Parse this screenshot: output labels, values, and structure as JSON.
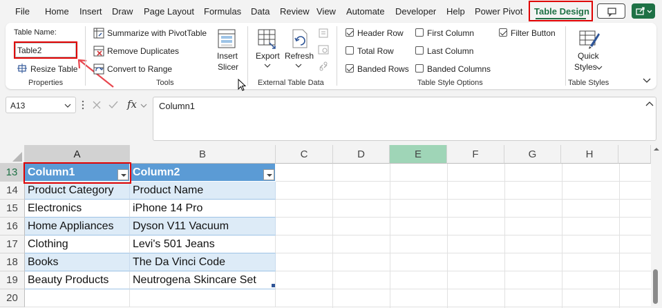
{
  "menu": {
    "tabs": [
      "File",
      "Home",
      "Insert",
      "Draw",
      "Page Layout",
      "Formulas",
      "Data",
      "Review",
      "View",
      "Automate",
      "Developer",
      "Help",
      "Power Pivot",
      "Table Design"
    ]
  },
  "ribbon": {
    "properties": {
      "table_name_label": "Table Name:",
      "table_name_value": "Table2",
      "resize_label": "Resize Table",
      "group_label": "Properties"
    },
    "tools": {
      "summarize_label": "Summarize with PivotTable",
      "remove_dup_label": "Remove Duplicates",
      "convert_label": "Convert to Range",
      "insert_slicer_line1": "Insert",
      "insert_slicer_line2": "Slicer",
      "group_label": "Tools"
    },
    "external": {
      "export_label": "Export",
      "refresh_label": "Refresh",
      "group_label": "External Table Data"
    },
    "style_options": {
      "header_row": "Header Row",
      "total_row": "Total Row",
      "banded_rows": "Banded Rows",
      "first_column": "First Column",
      "last_column": "Last Column",
      "banded_columns": "Banded Columns",
      "filter_button": "Filter Button",
      "group_label": "Table Style Options"
    },
    "styles": {
      "quick_line1": "Quick",
      "quick_line2": "Styles",
      "group_label": "Table Styles"
    }
  },
  "formula_bar": {
    "name_box": "A13",
    "fx": "fx",
    "content": "Column1"
  },
  "grid": {
    "columns": [
      "A",
      "B",
      "C",
      "D",
      "E",
      "F",
      "G",
      "H"
    ],
    "rows": [
      "13",
      "14",
      "15",
      "16",
      "17",
      "18",
      "19",
      "20"
    ],
    "table_header": [
      "Column1",
      "Column2"
    ],
    "table_rows": [
      [
        "Product Category",
        "Product Name"
      ],
      [
        "Electronics",
        "iPhone 14 Pro"
      ],
      [
        "Home Appliances",
        "Dyson V11 Vacuum"
      ],
      [
        "Clothing",
        "Levi's 501 Jeans"
      ],
      [
        "Books",
        "The Da Vinci Code"
      ],
      [
        "Beauty Products",
        "Neutrogena Skincare Set"
      ]
    ]
  },
  "colors": {
    "accent": "#1e7145",
    "table_header": "#5b9bd5",
    "table_band": "#ddebf7",
    "highlight": "#e00000"
  }
}
